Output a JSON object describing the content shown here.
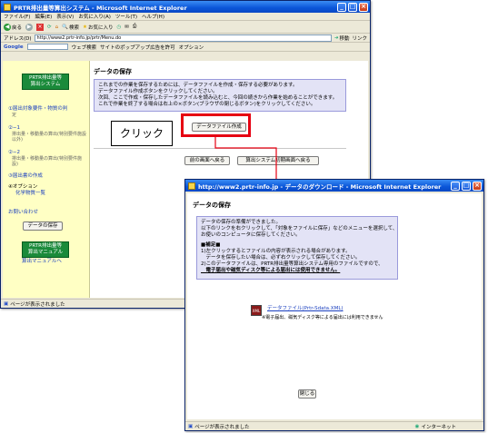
{
  "main_window": {
    "title": "PRTR排出量等算出システム - Microsoft Internet Explorer",
    "menu": [
      "ファイル(F)",
      "編集(E)",
      "表示(V)",
      "お気に入り(A)",
      "ツール(T)",
      "ヘルプ(H)"
    ],
    "toolbar": {
      "back": "戻る",
      "search": "検索",
      "favorites": "お気に入り"
    },
    "address_label": "アドレス(D)",
    "address_value": "http://www2.prtr-info.jp/prtr/Menu.do",
    "go_label": "移動",
    "links_label": "リンク",
    "google_label": "Google",
    "google_items": [
      "ウェブ検索",
      "サイトのポップアップ広告を許可",
      "オプション"
    ],
    "status": "ページが表示されました",
    "sidebar": {
      "logo_line1": "PRTR排出量等",
      "logo_line2": "算出システム",
      "links": [
        {
          "text": "①届出対象要件・物質の判",
          "sub": "定"
        },
        {
          "text": "②−1",
          "sub": "排出量・移動量の算出(特別要件施設以外)"
        },
        {
          "text": "②−2",
          "sub": "排出量・移動量の算出(特別要件施設)"
        },
        {
          "text": "③届出書の作成",
          "sub": ""
        },
        {
          "text": "④オプション",
          "sub": "化学物質一覧"
        }
      ],
      "contact": "お問い合わせ",
      "save_button": "データの保存",
      "manual_line1": "PRTR排出量等",
      "manual_line2": "算出マニュアル",
      "manual_link": "算出マニュアルへ"
    },
    "main": {
      "heading": "データの保存",
      "info_lines": [
        "これまでの作業を保存するためには、データファイルを作成・保存する必要があります。",
        "データファイル作成ボタンをクリックしてください。",
        "次回、ここで作成・保存したデータファイルを読み込むと、今回の続きから作業を始めることができます。",
        "これで作業を終了する場合は右上の×ボタン(ブラウザの閉じるボタン)をクリックしてください。"
      ],
      "create_button": "データファイル作成",
      "back_button": "前の画面へ戻る",
      "top_button": "算出システム初期画面へ戻る"
    }
  },
  "callout": "クリック",
  "popup_window": {
    "title": "http://www2.prtr-info.jp - データのダウンロード - Microsoft Internet Explorer",
    "heading": "データの保存",
    "intro_lines": [
      "データの保存の準備ができました。",
      "以下のリンクを右クリックして、「対象をファイルに保存」などのメニューを選択して、",
      "お使いのコンピュータに保存してください。"
    ],
    "notes_title": "■補足■",
    "note_lines": [
      "1)左クリックするとファイルの内容が表示される場合があります。",
      "　データを保存したい場合は、必ず右クリックして保存してください。",
      "2)このデータファイルは、PRTR排出量等算出システム専用のファイルですので、",
      "　電子届出や磁気ディスク等による届出には使用できません。"
    ],
    "file_link": "データファイル(Prtr-Sdata.XML)",
    "file_note": "※電子届出、磁気ディスク等による届出には利用できません",
    "close_button": "閉じる",
    "status": "ページが表示されました",
    "zone": "インターネット"
  }
}
